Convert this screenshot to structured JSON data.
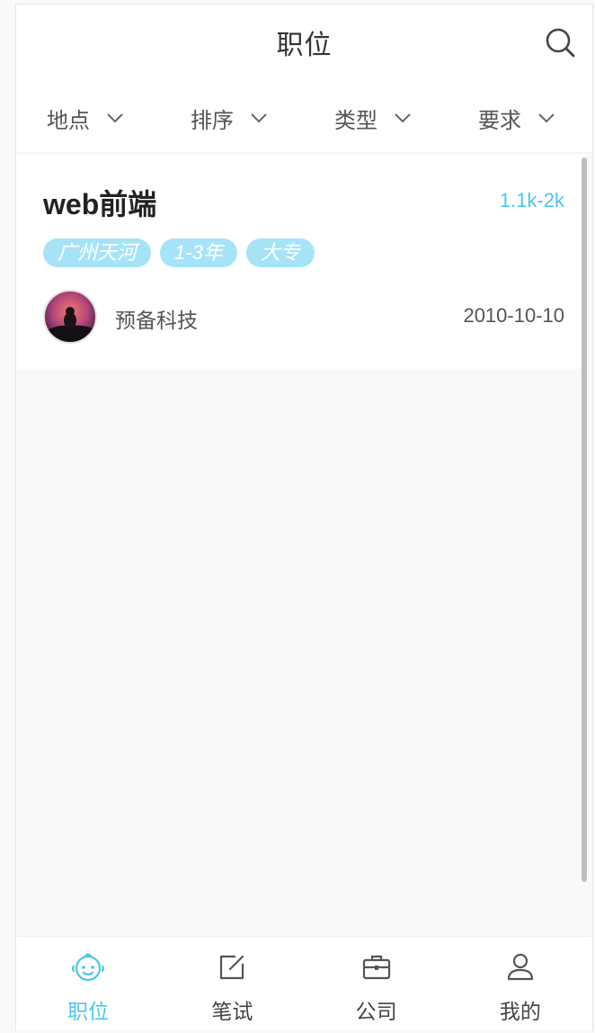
{
  "colors": {
    "accent": "#4cc6ea",
    "tag_bg": "#a7e3f7",
    "text_primary": "#222222",
    "text_secondary": "#555555",
    "background": "#f9f9f9"
  },
  "header": {
    "title": "职位",
    "search_icon": "search-icon"
  },
  "filters": [
    {
      "label": "地点",
      "icon": "chevron-down-icon"
    },
    {
      "label": "排序",
      "icon": "chevron-down-icon"
    },
    {
      "label": "类型",
      "icon": "chevron-down-icon"
    },
    {
      "label": "要求",
      "icon": "chevron-down-icon"
    }
  ],
  "jobs": [
    {
      "title": "web前端",
      "salary": "1.1k-2k",
      "tags": [
        "广州天河",
        "1-3年",
        "大专"
      ],
      "company": "预备科技",
      "date": "2010-10-10",
      "avatar_icon": "company-avatar"
    }
  ],
  "tabbar": {
    "active_index": 0,
    "tabs": [
      {
        "label": "职位",
        "icon": "baby-face-icon"
      },
      {
        "label": "笔试",
        "icon": "edit-icon"
      },
      {
        "label": "公司",
        "icon": "briefcase-icon"
      },
      {
        "label": "我的",
        "icon": "user-icon"
      }
    ]
  }
}
